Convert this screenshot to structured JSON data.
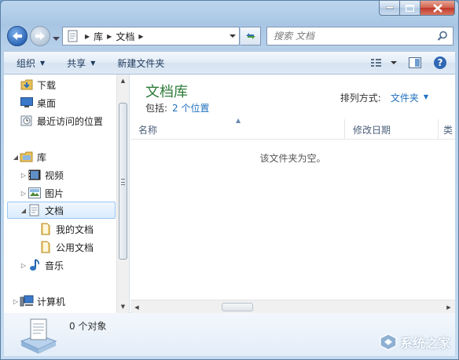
{
  "address": {
    "breadcrumbs": [
      "库",
      "文档"
    ]
  },
  "search": {
    "placeholder": "搜索 文档"
  },
  "toolbar": {
    "organize": "组织",
    "share": "共享",
    "new_folder": "新建文件夹"
  },
  "nav": {
    "items": [
      {
        "label": "下载",
        "icon": "downloads-icon"
      },
      {
        "label": "桌面",
        "icon": "desktop-icon"
      },
      {
        "label": "最近访问的位置",
        "icon": "recent-places-icon"
      },
      {
        "label": "库",
        "icon": "libraries-icon"
      },
      {
        "label": "视频",
        "icon": "videos-icon"
      },
      {
        "label": "图片",
        "icon": "pictures-icon"
      },
      {
        "label": "文档",
        "icon": "documents-icon"
      },
      {
        "label": "我的文档",
        "icon": "folder-icon"
      },
      {
        "label": "公用文档",
        "icon": "folder-icon"
      },
      {
        "label": "音乐",
        "icon": "music-icon"
      },
      {
        "label": "计算机",
        "icon": "computer-icon"
      }
    ]
  },
  "library": {
    "title": "文档库",
    "include_label": "包括:",
    "locations_link": "2 个位置",
    "arrange_label": "排列方式:",
    "arrange_value": "文件夹"
  },
  "columns": [
    "名称",
    "修改日期",
    "类"
  ],
  "empty_message": "该文件夹为空。",
  "details": {
    "count_text": "0 个对象"
  },
  "colors": {
    "library_title": "#2c7b39",
    "link": "#1e6fbf",
    "selection_border": "#97c5f2"
  },
  "watermark": {
    "text": "系统之家"
  }
}
